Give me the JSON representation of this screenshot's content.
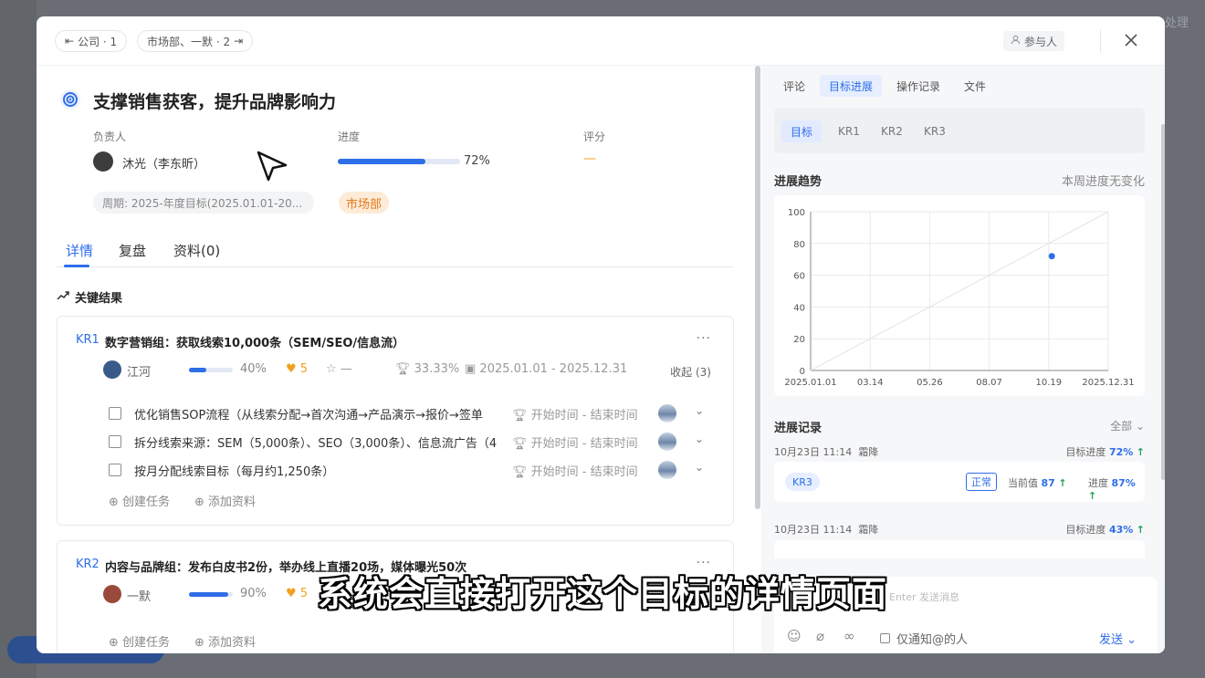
{
  "background": {
    "right_button": "处理"
  },
  "header": {
    "crumb_company": "公司 · 1",
    "crumb_depts": "市场部、一默 · 2",
    "participants": "参与人"
  },
  "objective": {
    "title": "支撑销售获客，提升品牌影响力",
    "owner_label": "负责人",
    "owner_name": "沐光（李东昕）",
    "progress_label": "进度",
    "progress_value": "72%",
    "progress_fraction": 0.72,
    "score_label": "评分",
    "score_value": "—",
    "period": "周期: 2025-年度目标(2025.01.01-20...",
    "department": "市场部"
  },
  "tabs": {
    "detail": "详情",
    "review": "复盘",
    "materials": "资料(0)"
  },
  "section_title": "关键结果",
  "kr1": {
    "tag": "KR1",
    "title": "数字营销组：获取线索10,000条（SEM/SEO/信息流）",
    "more": "···",
    "owner": "江河",
    "progress": "40%",
    "progress_fraction": 0.4,
    "likes": "5",
    "rating": "—",
    "completion": "33.33%",
    "date_range": "2025.01.01 - 2025.12.31",
    "collapse": "收起 (3)",
    "tasks": [
      {
        "text": "优化销售SOP流程（从线索分配→首次沟通→产品演示→报价→签单",
        "time": "开始时间 - 结束时间"
      },
      {
        "text": "拆分线索来源：SEM（5,000条）、SEO（3,000条）、信息流广告（4,",
        "time": "开始时间 - 结束时间"
      },
      {
        "text": "按月分配线索目标（每月约1,250条）",
        "time": "开始时间 - 结束时间"
      }
    ],
    "create_task": "创建任务",
    "add_material": "添加资料"
  },
  "kr2": {
    "tag": "KR2",
    "title": "内容与品牌组：发布白皮书2份，举办线上直播20场，媒体曝光50次",
    "more": "···",
    "owner": "一默",
    "progress": "90%",
    "progress_fraction": 0.9,
    "likes": "5",
    "create_task": "创建任务",
    "add_material": "添加资料"
  },
  "right_panel": {
    "tabs": [
      "评论",
      "目标进展",
      "操作记录",
      "文件"
    ],
    "active_tab": 1,
    "sub_tabs": [
      "目标",
      "KR1",
      "KR2",
      "KR3"
    ],
    "active_sub_tab": 0,
    "trend_title": "进展趋势",
    "trend_note": "本周进度无变化",
    "records_title": "进展记录",
    "records_filter": "全部",
    "records": [
      {
        "time": "10月23日 11:14",
        "user": "霜降",
        "goal_label": "目标进度",
        "goal_value": "72%",
        "kr": "KR3",
        "status": "正常",
        "current_label": "当前值",
        "current_value": "87",
        "progress_label": "进度",
        "progress_value": "87%"
      },
      {
        "time": "10月23日 11:14",
        "user": "霜降",
        "goal_label": "目标进度",
        "goal_value": "43%"
      }
    ],
    "composer_placeholder": "Enter 发送消息",
    "notify_label": "仅通知@的人",
    "send": "发送"
  },
  "chart_data": {
    "type": "line",
    "x_ticks": [
      "2025.01.01",
      "03.14",
      "05.26",
      "08.07",
      "10.19",
      "2025.12.31"
    ],
    "y_ticks": [
      0,
      20,
      40,
      60,
      80,
      100
    ],
    "ylim": [
      0,
      100
    ],
    "xlim": [
      "2025.01.01",
      "2025.12.31"
    ],
    "series": [
      {
        "points": [
          {
            "x": "2025.10.23",
            "y": 72
          }
        ]
      }
    ],
    "reference_line": [
      {
        "x": "2025.01.01",
        "y": 0
      },
      {
        "x": "2025.12.31",
        "y": 100
      }
    ],
    "grid": true
  },
  "subtitle": "系统会直接打开这个目标的详情页面",
  "colors": {
    "accent": "#2e6ee8",
    "warning": "#f0a020",
    "dept_chip_bg": "#fdebd8",
    "up_arrow": "#22a35a"
  }
}
